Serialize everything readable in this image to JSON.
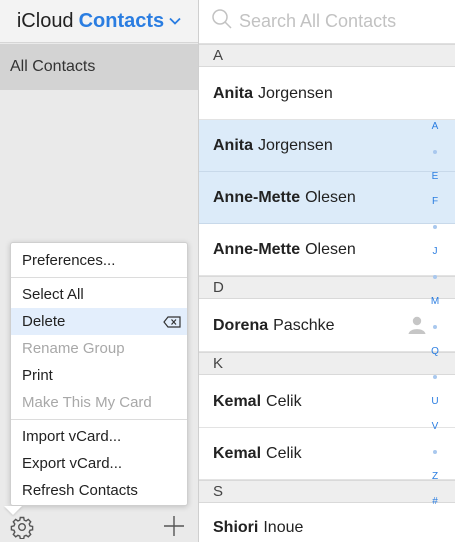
{
  "header": {
    "app_name": "iCloud",
    "section": "Contacts"
  },
  "sidebar": {
    "group_label": "All Contacts"
  },
  "menu": {
    "preferences": "Preferences...",
    "select_all": "Select All",
    "delete": "Delete",
    "rename_group": "Rename Group",
    "print": "Print",
    "make_my_card": "Make This My Card",
    "import_vcard": "Import vCard...",
    "export_vcard": "Export vCard...",
    "refresh": "Refresh Contacts"
  },
  "search": {
    "placeholder": "Search All Contacts"
  },
  "sections": {
    "a": "A",
    "d": "D",
    "k": "K",
    "s": "S"
  },
  "contacts": [
    {
      "first": "Anita",
      "last": "Jorgensen",
      "selected": false
    },
    {
      "first": "Anita",
      "last": "Jorgensen",
      "selected": true
    },
    {
      "first": "Anne-Mette",
      "last": "Olesen",
      "selected": true
    },
    {
      "first": "Anne-Mette",
      "last": "Olesen",
      "selected": false
    },
    {
      "first": "Dorena",
      "last": "Paschke",
      "selected": false
    },
    {
      "first": "Kemal",
      "last": "Celik",
      "selected": false
    },
    {
      "first": "Kemal",
      "last": "Celik",
      "selected": false
    },
    {
      "first": "Shiori",
      "last": "Inoue",
      "selected": false
    }
  ],
  "index_letters": {
    "a": "A",
    "e": "E",
    "f": "F",
    "j": "J",
    "m": "M",
    "q": "Q",
    "u": "U",
    "v": "V",
    "z": "Z",
    "hash": "#"
  },
  "colors": {
    "accent": "#2a7de1",
    "selected_row": "#dcebf9",
    "menu_highlight": "#e3eefc",
    "sidebar_bg": "#eaeaea"
  },
  "icons": {
    "chevron": "chevron-down-icon",
    "search": "search-icon",
    "gear": "gear-icon",
    "plus": "plus-icon",
    "backspace": "backspace-icon",
    "avatar": "person-placeholder-icon"
  }
}
